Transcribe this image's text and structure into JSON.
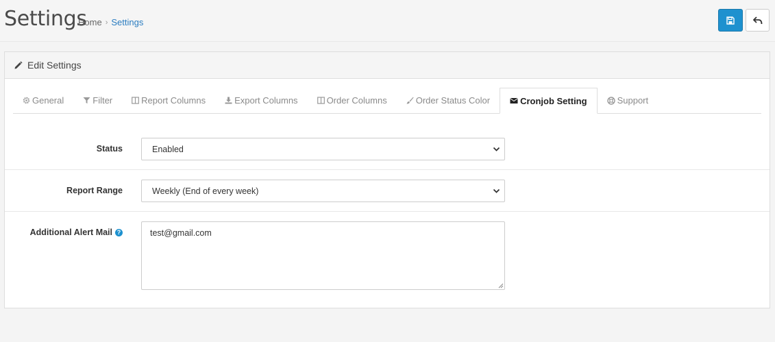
{
  "header": {
    "title": "Settings",
    "breadcrumb": [
      {
        "label": "Home"
      },
      {
        "label": "Settings"
      }
    ],
    "breadcrumb_separator": "›",
    "save_icon": "floppy-disk-icon",
    "back_icon": "reply-arrow-icon"
  },
  "panel": {
    "heading": "Edit Settings",
    "heading_icon": "pencil-icon"
  },
  "tabs": [
    {
      "label": "General",
      "icon": "gear-icon",
      "active": false
    },
    {
      "label": "Filter",
      "icon": "filter-icon",
      "active": false
    },
    {
      "label": "Report Columns",
      "icon": "columns-icon",
      "active": false
    },
    {
      "label": "Export Columns",
      "icon": "download-icon",
      "active": false
    },
    {
      "label": "Order Columns",
      "icon": "columns-icon",
      "active": false
    },
    {
      "label": "Order Status Color",
      "icon": "brush-icon",
      "active": false
    },
    {
      "label": "Cronjob Setting",
      "icon": "envelope-icon",
      "active": true
    },
    {
      "label": "Support",
      "icon": "life-ring-icon",
      "active": false
    }
  ],
  "form": {
    "status": {
      "label": "Status",
      "value": "Enabled"
    },
    "report_range": {
      "label": "Report Range",
      "value": "Weekly (End of every week)"
    },
    "alert_mail": {
      "label": "Additional Alert Mail",
      "value": "test@gmail.com",
      "help_icon": "question-circle-icon"
    }
  },
  "colors": {
    "primary": "#1e91cf",
    "link": "#2a7cc0",
    "background": "#f4f4f4"
  }
}
